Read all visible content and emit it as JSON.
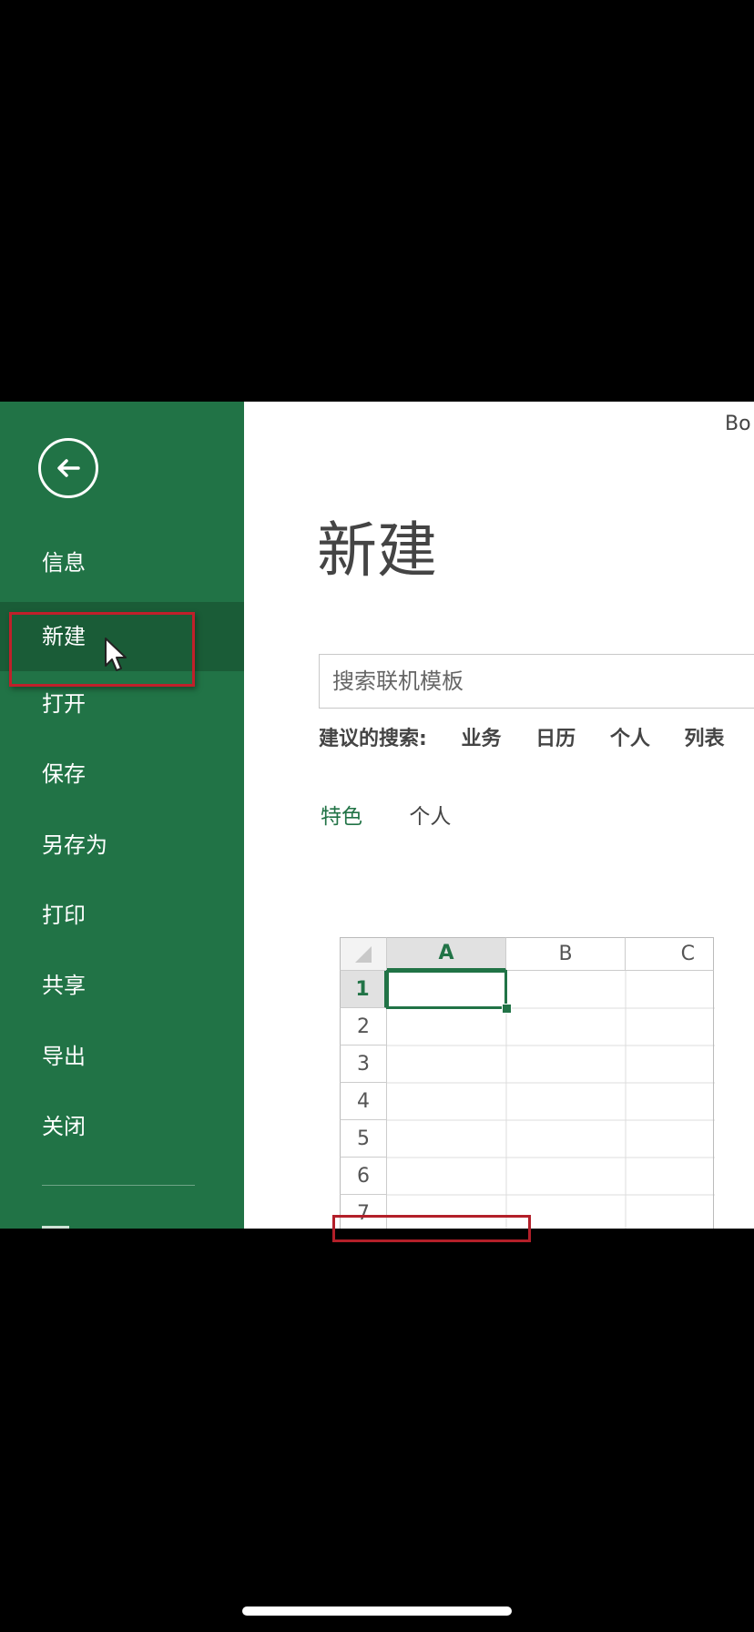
{
  "window": {
    "doc_title": "Bo"
  },
  "sidebar": {
    "back_label": "back",
    "items": [
      {
        "label": "信息"
      },
      {
        "label": "新建"
      },
      {
        "label": "打开"
      },
      {
        "label": "保存"
      },
      {
        "label": "另存为"
      },
      {
        "label": "打印"
      },
      {
        "label": "共享"
      },
      {
        "label": "导出"
      },
      {
        "label": "关闭"
      }
    ],
    "active_item": "新建"
  },
  "main": {
    "title": "新建",
    "search": {
      "placeholder": "搜索联机模板"
    },
    "suggested": {
      "label": "建议的搜索:",
      "links": [
        "业务",
        "日历",
        "个人",
        "列表"
      ]
    },
    "tabs": [
      "特色",
      "个人"
    ]
  },
  "template_preview": {
    "columns": [
      "A",
      "B",
      "C"
    ],
    "rows": [
      "1",
      "2",
      "3",
      "4",
      "5",
      "6",
      "7"
    ]
  },
  "colors": {
    "sidebar_bg": "#217346",
    "sidebar_active": "#1a5c37",
    "accent": "#217346",
    "highlight_red": "#c0202a"
  },
  "icons": [
    "back-arrow-icon",
    "mouse-pointer-icon"
  ]
}
